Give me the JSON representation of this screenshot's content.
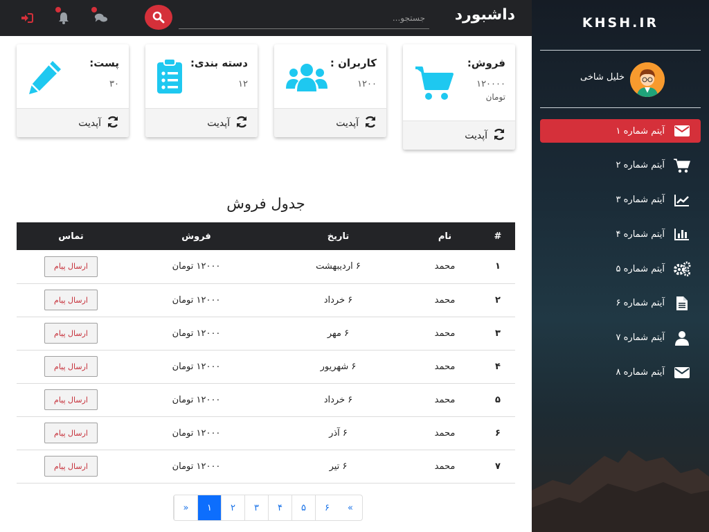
{
  "brand": "KHSH.IR",
  "user": {
    "name": "خلیل شاخی"
  },
  "sidebar": {
    "items": [
      {
        "label": "آیتم شماره ۱",
        "icon": "envelope-icon",
        "active": true
      },
      {
        "label": "آیتم شماره ۲",
        "icon": "cart-icon"
      },
      {
        "label": "آیتم شماره ۳",
        "icon": "line-chart-icon"
      },
      {
        "label": "آیتم شماره ۴",
        "icon": "bar-chart-icon"
      },
      {
        "label": "آیتم شماره ۵",
        "icon": "gears-icon"
      },
      {
        "label": "آیتم شماره ۶",
        "icon": "file-icon"
      },
      {
        "label": "آیتم شماره ۷",
        "icon": "user-icon"
      },
      {
        "label": "آیتم شماره ۸",
        "icon": "envelope-icon"
      }
    ]
  },
  "topbar": {
    "title": "داشبورد",
    "search_placeholder": "جستجو..."
  },
  "cards": {
    "sales": {
      "title": "فروش:",
      "value": "۱۲۰۰۰۰",
      "unit": "تومان",
      "footer": "آپدیت",
      "icon": "cart-icon"
    },
    "users": {
      "title": "کاربران :",
      "value": "۱۲۰۰",
      "footer": "آپدیت",
      "icon": "users-icon"
    },
    "categories": {
      "title": "دسته بندی:",
      "value": "۱۲",
      "footer": "آپدیت",
      "icon": "clipboard-list-icon"
    },
    "posts": {
      "title": "پست:",
      "value": "۳۰",
      "footer": "آپدیت",
      "icon": "pencil-icon"
    }
  },
  "table": {
    "title": "جدول فروش",
    "headers": [
      "#",
      "نام",
      "تاریخ",
      "فروش",
      "تماس"
    ],
    "rows": [
      {
        "num": "۱",
        "name": "محمد",
        "date": "۶ اردیبهشت",
        "sale": "۱۲۰۰۰ تومان",
        "action": "ارسال پیام"
      },
      {
        "num": "۲",
        "name": "محمد",
        "date": "۶ خرداد",
        "sale": "۱۲۰۰۰ تومان",
        "action": "ارسال پیام"
      },
      {
        "num": "۳",
        "name": "محمد",
        "date": "۶ مهر",
        "sale": "۱۲۰۰۰ تومان",
        "action": "ارسال پیام"
      },
      {
        "num": "۴",
        "name": "محمد",
        "date": "۶ شهریور",
        "sale": "۱۲۰۰۰ تومان",
        "action": "ارسال پیام"
      },
      {
        "num": "۵",
        "name": "محمد",
        "date": "۶ خرداد",
        "sale": "۱۲۰۰۰ تومان",
        "action": "ارسال پیام"
      },
      {
        "num": "۶",
        "name": "محمد",
        "date": "۶ آذر",
        "sale": "۱۲۰۰۰ تومان",
        "action": "ارسال پیام"
      },
      {
        "num": "۷",
        "name": "محمد",
        "date": "۶ تیر",
        "sale": "۱۲۰۰۰ تومان",
        "action": "ارسال پیام"
      }
    ]
  },
  "pagination": {
    "prev": "«",
    "pages": [
      "۱",
      "۲",
      "۳",
      "۴",
      "۵",
      "۶"
    ],
    "active": "۱",
    "next": "»"
  },
  "colors": {
    "accent": "#d5303a",
    "cyan": "#1ec8f0",
    "topbar": "#222326",
    "pagination_active": "#0d6efd"
  }
}
